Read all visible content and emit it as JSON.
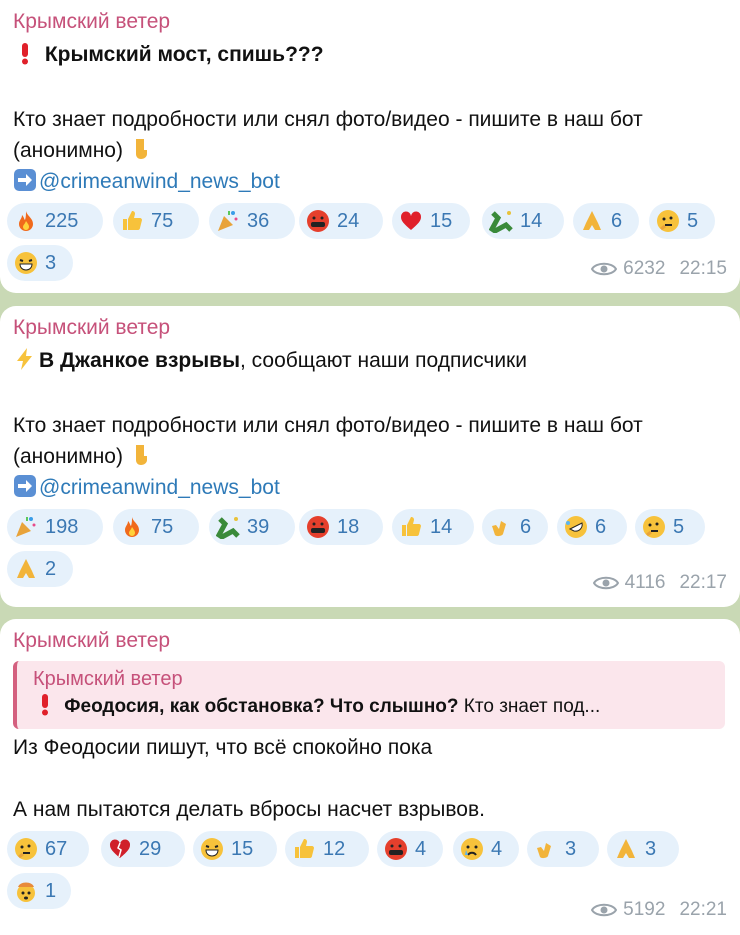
{
  "posts": [
    {
      "author": "Крымский ветер",
      "line1_bold": "Крымский мост, спишь???",
      "line1_rest": "",
      "body": "Кто знает подробности или снял фото/видео - пишите в наш бот",
      "body2": "(анонимно)",
      "link": "@crimeanwind_news_bot",
      "views": "6232",
      "time": "22:15",
      "reactions": [
        {
          "icon": "fire-icon",
          "count": "225"
        },
        {
          "icon": "thumbs-up-icon",
          "count": "75"
        },
        {
          "icon": "party-popper-icon",
          "count": "36"
        },
        {
          "icon": "angry-cursing-face-icon",
          "count": "24"
        },
        {
          "icon": "heart-icon",
          "count": "15"
        },
        {
          "icon": "champagne-icon",
          "count": "14"
        },
        {
          "icon": "praying-hands-icon",
          "count": "6"
        },
        {
          "icon": "thinking-face-icon",
          "count": "5"
        },
        {
          "icon": "grinning-face-icon",
          "count": "3"
        }
      ]
    },
    {
      "author": "Крымский ветер",
      "line1_bold": "В Джанкое взрывы",
      "line1_rest": ", сообщают наши подписчики",
      "body": "Кто знает подробности или снял фото/видео - пишите в наш бот",
      "body2": "(анонимно)",
      "link": "@crimeanwind_news_bot",
      "views": "4116",
      "time": "22:17",
      "reactions": [
        {
          "icon": "party-popper-icon",
          "count": "198"
        },
        {
          "icon": "fire-icon",
          "count": "75"
        },
        {
          "icon": "champagne-icon",
          "count": "39"
        },
        {
          "icon": "angry-cursing-face-icon",
          "count": "18"
        },
        {
          "icon": "thumbs-up-icon",
          "count": "14"
        },
        {
          "icon": "clapping-hands-icon",
          "count": "6"
        },
        {
          "icon": "rofl-face-icon",
          "count": "6"
        },
        {
          "icon": "thinking-face-icon",
          "count": "5"
        },
        {
          "icon": "praying-hands-icon",
          "count": "2"
        }
      ]
    },
    {
      "author": "Крымский ветер",
      "reply_author": "Крымский ветер",
      "reply_bold": "Феодосия, как обстановка? Что слышно?",
      "reply_rest": "  Кто знает под...",
      "body": "Из Феодосии пишут, что всё спокойно пока",
      "body2": "А нам пытаются делать вбросы насчет взрывов.",
      "views": "5192",
      "time": "22:21",
      "reactions": [
        {
          "icon": "thinking-face-icon",
          "count": "67"
        },
        {
          "icon": "broken-heart-icon",
          "count": "29"
        },
        {
          "icon": "grinning-face-icon",
          "count": "15"
        },
        {
          "icon": "thumbs-up-icon",
          "count": "12"
        },
        {
          "icon": "angry-cursing-face-icon",
          "count": "4"
        },
        {
          "icon": "crying-face-icon",
          "count": "4"
        },
        {
          "icon": "clapping-hands-icon",
          "count": "3"
        },
        {
          "icon": "praying-hands-icon",
          "count": "3"
        },
        {
          "icon": "exploding-head-icon",
          "count": "1"
        }
      ]
    }
  ],
  "colors": {
    "chat_background": "#c9d9b5",
    "author": "#c6517a",
    "link": "#2e7ab8",
    "reaction_chip": "#e6f1fb",
    "reaction_count": "#3b78b3",
    "meta": "#9aa3ab"
  }
}
